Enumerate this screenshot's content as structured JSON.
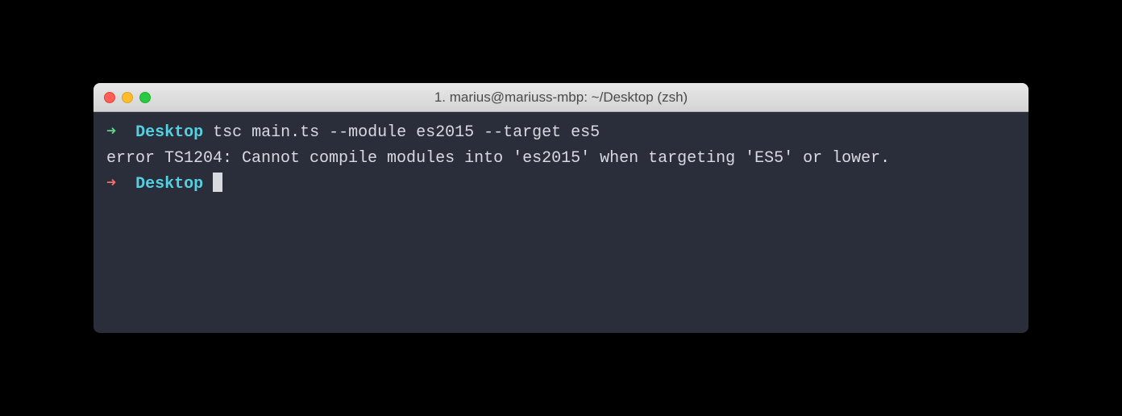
{
  "window": {
    "title": "1. marius@mariuss-mbp: ~/Desktop (zsh)"
  },
  "terminal": {
    "line1": {
      "arrow": "➜",
      "cwd": "Desktop",
      "command": "tsc main.ts --module es2015 --target es5"
    },
    "line2": {
      "error": "error TS1204: Cannot compile modules into 'es2015' when targeting 'ES5' or lower."
    },
    "line3": {
      "arrow": "➜",
      "cwd": "Desktop"
    }
  }
}
